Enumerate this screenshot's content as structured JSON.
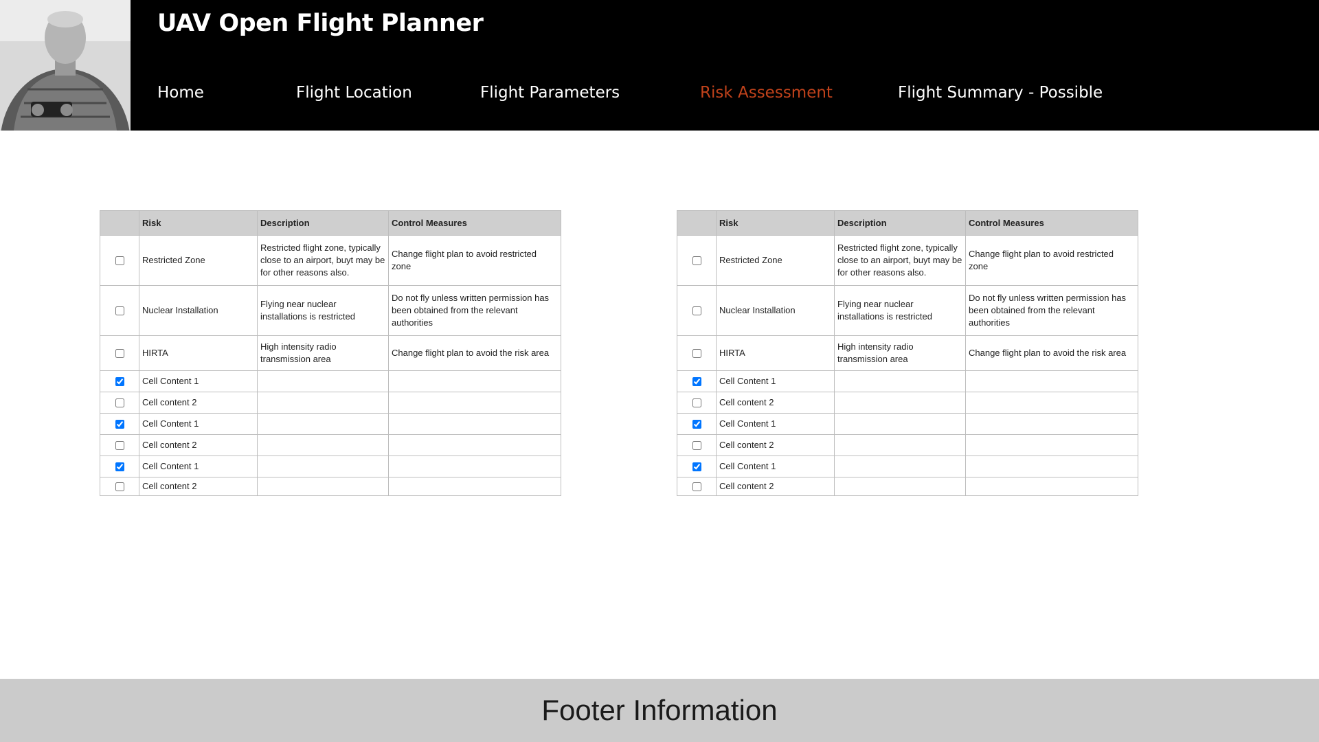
{
  "header": {
    "title": "UAV Open Flight Planner",
    "avatar_icon": "person-photo-icon"
  },
  "nav": {
    "items": [
      {
        "label": "Home",
        "active": false
      },
      {
        "label": "Flight Location",
        "active": false
      },
      {
        "label": "Flight Parameters",
        "active": false
      },
      {
        "label": "Risk Assessment",
        "active": true
      },
      {
        "label": "Flight Summary - Possible",
        "active": false
      }
    ],
    "active_color": "#c0421b"
  },
  "tables": [
    {
      "headers": [
        "",
        "Risk",
        "Description",
        "Control Measures"
      ],
      "rows": [
        {
          "checked": false,
          "risk": "Restricted Zone",
          "description": "Restricted flight zone, typically close to an airport, buyt may be for other reasons also.",
          "control": "Change flight plan to avoid restricted zone"
        },
        {
          "checked": false,
          "risk": "Nuclear Installation",
          "description": "Flying near nuclear installations is restricted",
          "control": "Do not fly unless written permission has been obtained from the relevant authorities"
        },
        {
          "checked": false,
          "risk": "HIRTA",
          "description": "High intensity radio transmission area",
          "control": "Change flight plan to avoid the risk area"
        },
        {
          "checked": true,
          "risk": "Cell Content 1",
          "description": "",
          "control": ""
        },
        {
          "checked": false,
          "risk": "Cell content 2",
          "description": "",
          "control": ""
        },
        {
          "checked": true,
          "risk": "Cell Content 1",
          "description": "",
          "control": ""
        },
        {
          "checked": false,
          "risk": "Cell content 2",
          "description": "",
          "control": ""
        },
        {
          "checked": true,
          "risk": "Cell Content 1",
          "description": "",
          "control": ""
        },
        {
          "checked": false,
          "risk": "Cell content 2",
          "description": "",
          "control": ""
        }
      ]
    },
    {
      "headers": [
        "",
        "Risk",
        "Description",
        "Control Measures"
      ],
      "rows": [
        {
          "checked": false,
          "risk": "Restricted Zone",
          "description": "Restricted flight zone, typically close to an airport, buyt may be for other reasons also.",
          "control": "Change flight plan to avoid restricted zone"
        },
        {
          "checked": false,
          "risk": "Nuclear Installation",
          "description": "Flying near nuclear installations is restricted",
          "control": "Do not fly unless written permission has been obtained from the relevant authorities"
        },
        {
          "checked": false,
          "risk": "HIRTA",
          "description": "High intensity radio transmission area",
          "control": "Change flight plan to avoid the risk area"
        },
        {
          "checked": true,
          "risk": "Cell Content 1",
          "description": "",
          "control": ""
        },
        {
          "checked": false,
          "risk": "Cell content 2",
          "description": "",
          "control": ""
        },
        {
          "checked": true,
          "risk": "Cell Content 1",
          "description": "",
          "control": ""
        },
        {
          "checked": false,
          "risk": "Cell content 2",
          "description": "",
          "control": ""
        },
        {
          "checked": true,
          "risk": "Cell Content 1",
          "description": "",
          "control": ""
        },
        {
          "checked": false,
          "risk": "Cell content 2",
          "description": "",
          "control": ""
        }
      ]
    }
  ],
  "footer": {
    "text": "Footer Information"
  }
}
